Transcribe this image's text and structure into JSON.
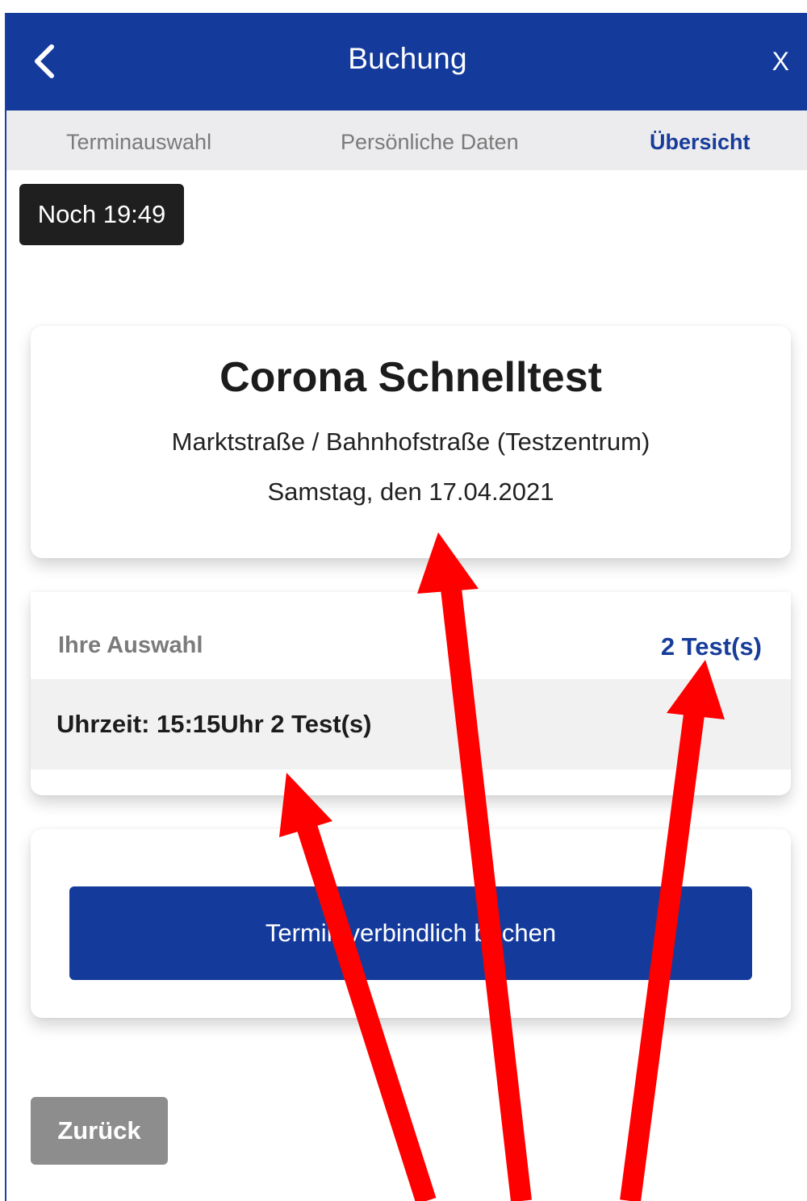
{
  "header": {
    "title": "Buchung",
    "close_label": "X",
    "back_icon": "chevron-left-icon"
  },
  "steps": [
    {
      "label": "Terminauswahl",
      "active": false
    },
    {
      "label": "Persönliche Daten",
      "active": false
    },
    {
      "label": "Übersicht",
      "active": true
    }
  ],
  "timer": {
    "label": "Noch 19:49"
  },
  "info": {
    "title": "Corona Schnelltest",
    "location": "Marktstraße / Bahnhofstraße (Testzentrum)",
    "date": "Samstag, den 17.04.2021"
  },
  "selection": {
    "label": "Ihre Auswahl",
    "count": "2 Test(s)",
    "row": "Uhrzeit: 15:15Uhr 2 Test(s)"
  },
  "actions": {
    "book_label": "Termin verbindlich buchen",
    "back_label": "Zurück"
  },
  "annotations": {
    "arrow_color": "#ff0000",
    "arrow_count": 3
  },
  "colors": {
    "primary": "#143b9c",
    "step_bar": "#ececee",
    "timer_bg": "#1f1f1f",
    "back_button": "#8d8d8d"
  }
}
